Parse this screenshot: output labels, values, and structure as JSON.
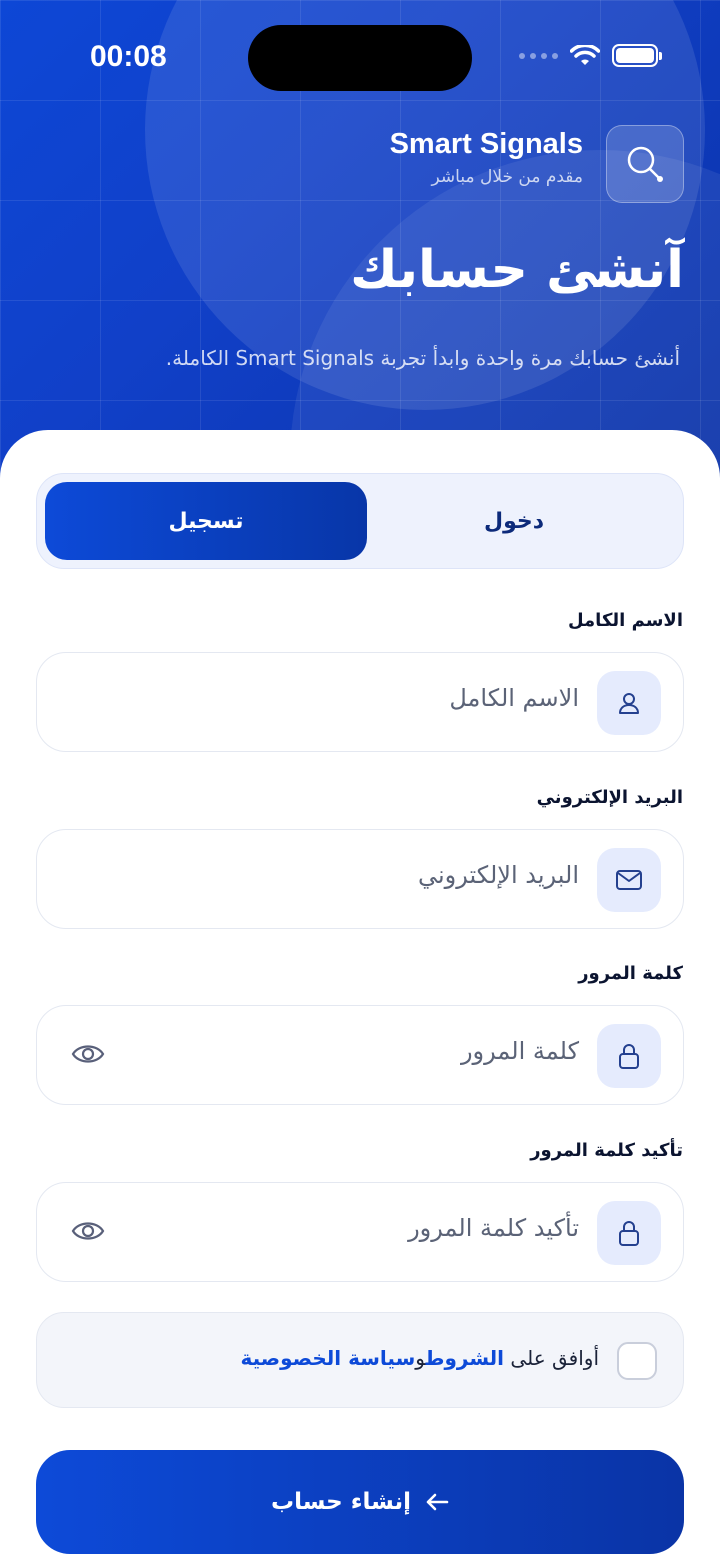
{
  "status_bar": {
    "time": "00:08"
  },
  "brand": {
    "title": "Smart Signals",
    "subtitle": "مقدم من خلال مباشر"
  },
  "hero": {
    "title": "آنشئ حسابك",
    "subtitle": "أنشئ حسابك مرة واحدة وابدأ تجربة Smart Signals الكاملة."
  },
  "tabs": {
    "register": "تسجيل",
    "login": "دخول",
    "active": "register"
  },
  "form": {
    "full_name": {
      "label": "الاسم الكامل",
      "placeholder": "الاسم الكامل",
      "icon": "user-icon"
    },
    "email": {
      "label": "البريد الإلكتروني",
      "placeholder": "البريد الإلكتروني",
      "icon": "mail-icon"
    },
    "password": {
      "label": "كلمة المرور",
      "placeholder": "كلمة المرور",
      "icon": "lock-icon"
    },
    "confirm_password": {
      "label": "تأكيد كلمة المرور",
      "placeholder": "تأكيد كلمة المرور",
      "icon": "lock-icon"
    }
  },
  "terms": {
    "prefix": "أوافق على",
    "terms_link": "الشروط",
    "joiner": "و",
    "privacy_link": "سياسة الخصوصية",
    "checked": false
  },
  "submit": {
    "label": "إنشاء حساب",
    "icon": "arrow-left-icon"
  },
  "colors": {
    "primary": "#0d4ad8",
    "primary_dark": "#0836a8",
    "icon_bg": "#e5ebfd",
    "text_dark": "#0b1430"
  }
}
